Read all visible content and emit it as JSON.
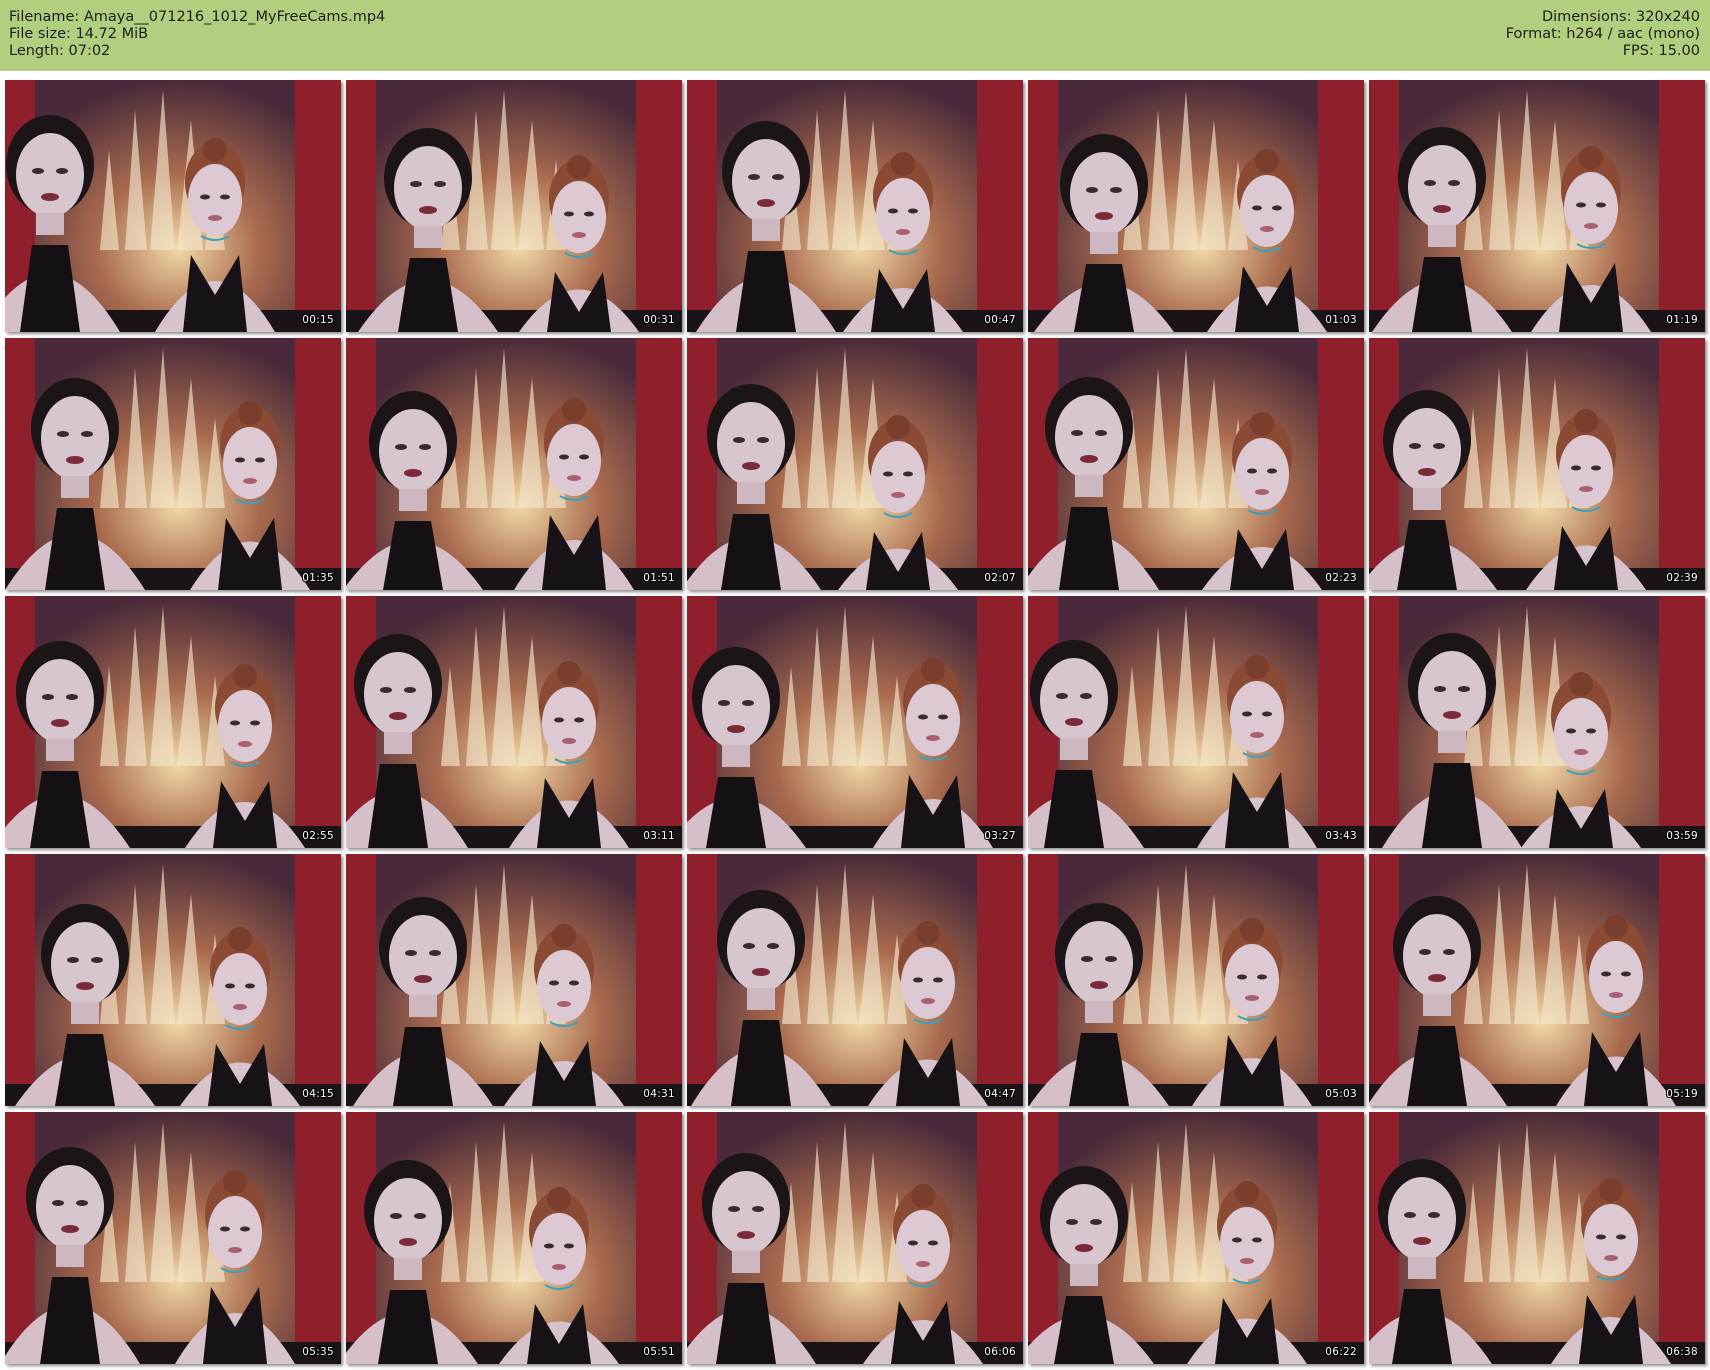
{
  "header": {
    "filename_line": "Filename: Amaya__071216_1012_MyFreeCams.mp4",
    "filesize_line": "File size: 14.72 MiB",
    "length_line": "Length: 07:02",
    "dimensions_line": "Dimensions: 320x240",
    "format_line": "Format: h264 / aac (mono)",
    "fps_line": "FPS: 15.00"
  },
  "colors": {
    "header_bg": "#b2cf7f",
    "wall_red": "#8f1f2a",
    "tapestry": "#a86a4e"
  },
  "thumbnails": [
    {
      "timestamp": "00:15"
    },
    {
      "timestamp": "00:31"
    },
    {
      "timestamp": "00:47"
    },
    {
      "timestamp": "01:03"
    },
    {
      "timestamp": "01:19"
    },
    {
      "timestamp": "01:35"
    },
    {
      "timestamp": "01:51"
    },
    {
      "timestamp": "02:07"
    },
    {
      "timestamp": "02:23"
    },
    {
      "timestamp": "02:39"
    },
    {
      "timestamp": "02:55"
    },
    {
      "timestamp": "03:11"
    },
    {
      "timestamp": "03:27"
    },
    {
      "timestamp": "03:43"
    },
    {
      "timestamp": "03:59"
    },
    {
      "timestamp": "04:15"
    },
    {
      "timestamp": "04:31"
    },
    {
      "timestamp": "04:47"
    },
    {
      "timestamp": "05:03"
    },
    {
      "timestamp": "05:19"
    },
    {
      "timestamp": "05:35"
    },
    {
      "timestamp": "05:51"
    },
    {
      "timestamp": "06:06"
    },
    {
      "timestamp": "06:22"
    },
    {
      "timestamp": "06:38"
    }
  ]
}
